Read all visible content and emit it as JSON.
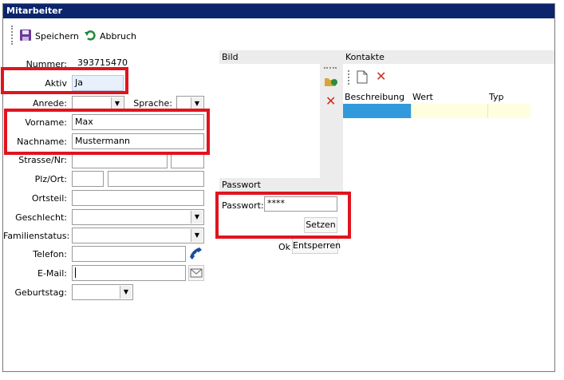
{
  "window": {
    "title": "Mitarbeiter"
  },
  "toolbar": {
    "save_label": "Speichern",
    "cancel_label": "Abbruch"
  },
  "form": {
    "nummer_label": "Nummer:",
    "nummer_value": "393715470",
    "aktiv_label": "Aktiv",
    "aktiv_value": "Ja",
    "anrede_label": "Anrede:",
    "sprache_label": "Sprache:",
    "vorname_label": "Vorname:",
    "vorname_value": "Max",
    "nachname_label": "Nachname:",
    "nachname_value": "Mustermann",
    "strasse_label": "Strasse/Nr:",
    "plz_label": "Plz/Ort:",
    "ortsteil_label": "Ortsteil:",
    "geschlecht_label": "Geschlecht:",
    "familienstatus_label": "Familienstatus:",
    "telefon_label": "Telefon:",
    "email_label": "E-Mail:",
    "geburtstag_label": "Geburtstag:"
  },
  "bild": {
    "title": "Bild"
  },
  "kontakte": {
    "title": "Kontakte",
    "columns": [
      "Beschreibung",
      "Wert",
      "Typ"
    ]
  },
  "passwort": {
    "title": "Passwort",
    "label": "Passwort:",
    "value": "****",
    "set_button": "Setzen",
    "status": "Ok",
    "unlock_button": "Entsperren"
  },
  "colors": {
    "title_bar": "#0b246b",
    "highlight_box": "#e0141e",
    "selected_row": "#3399dd",
    "new_row": "#ffffe0"
  }
}
